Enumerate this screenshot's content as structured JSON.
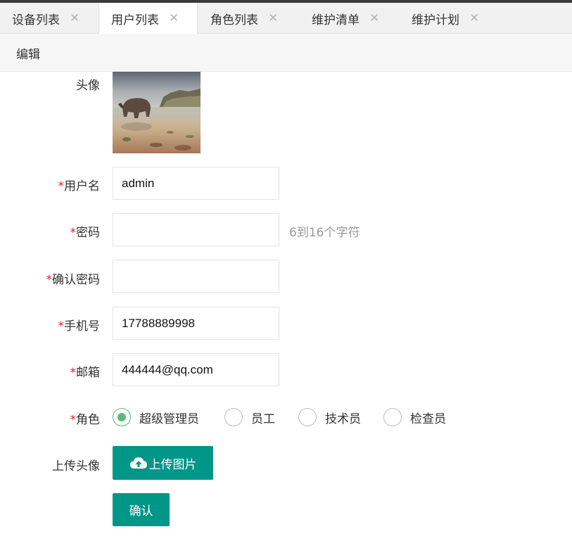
{
  "tabs": [
    {
      "label": "设备列表",
      "active": false
    },
    {
      "label": "用户列表",
      "active": true
    },
    {
      "label": "角色列表",
      "active": false
    },
    {
      "label": "维护清单",
      "active": false
    },
    {
      "label": "维护计划",
      "active": false
    }
  ],
  "tab_close_glyph": "✕",
  "subbar": {
    "title": "编辑"
  },
  "form": {
    "avatar_label": "头像",
    "required_mark": "*",
    "username": {
      "label": "用户名",
      "value": "admin"
    },
    "password": {
      "label": "密码",
      "value": "",
      "hint": "6到16个字符"
    },
    "confirm_password": {
      "label": "确认密码",
      "value": ""
    },
    "phone": {
      "label": "手机号",
      "value": "17788889998"
    },
    "email": {
      "label": "邮箱",
      "value": "444444@qq.com"
    },
    "role": {
      "label": "角色",
      "options": [
        "超级管理员",
        "员工",
        "技术员",
        "检查员"
      ],
      "selected": "超级管理员"
    },
    "upload": {
      "label": "上传头像",
      "button": "上传图片",
      "icon": "cloud-upload-icon"
    },
    "confirm_button": "确认"
  },
  "colors": {
    "primary": "#009688",
    "radio_checked": "#5fb878",
    "required": "#e02020",
    "hint": "#999999"
  }
}
